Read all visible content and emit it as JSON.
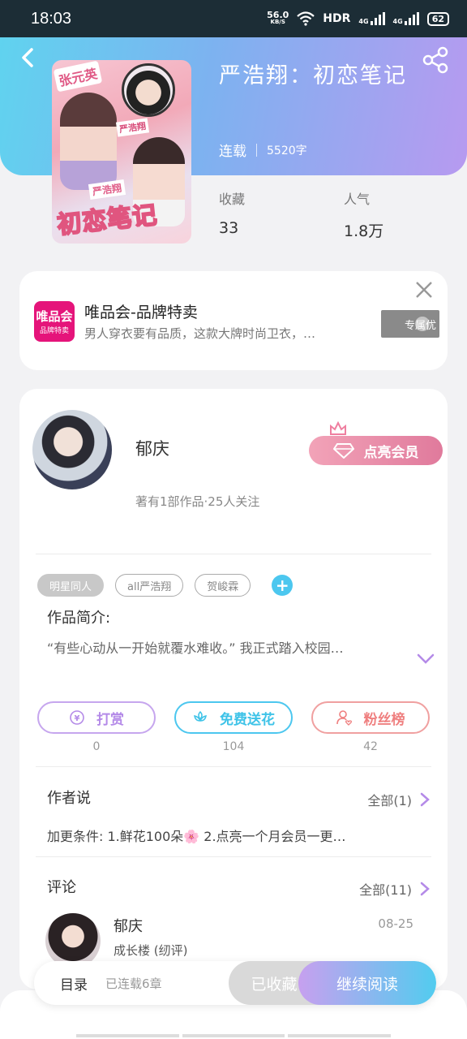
{
  "status_bar": {
    "time": "18:03",
    "net_speed": "56.0",
    "net_unit": "KB/S",
    "hd": "HDR",
    "sig1": "4G",
    "sig2": "4G",
    "battery": "62"
  },
  "book": {
    "title": "严浩翔：初恋笔记",
    "status": "连载",
    "word_count": "5520字",
    "cover_tags": [
      "张元英",
      "严浩翔",
      "严浩翔",
      "初恋笔记"
    ],
    "stats": [
      {
        "label": "收藏",
        "value": "33"
      },
      {
        "label": "人气",
        "value": "1.8万"
      }
    ]
  },
  "ad": {
    "logo_main": "唯品会",
    "logo_sub": "品牌特卖",
    "title": "唯品会-品牌特卖",
    "desc": "男人穿衣要有品质，这款大牌时尚卫衣，…",
    "button": "专属优"
  },
  "author": {
    "name": "郁庆",
    "info": "著有1部作品·25人关注",
    "vip_button": "点亮会员"
  },
  "tags": [
    "明星同人",
    "all严浩翔",
    "贺峻霖"
  ],
  "intro": {
    "label": "作品简介:",
    "text": "“有些心动从一开始就覆水难收。”  我正式踏入校园…"
  },
  "actions": [
    {
      "label": "打赏",
      "count": "0",
      "color": "#b48ae8",
      "icon": "coin-icon"
    },
    {
      "label": "免费送花",
      "count": "104",
      "color": "#3ec3e8",
      "icon": "flower-icon"
    },
    {
      "label": "粉丝榜",
      "count": "42",
      "color": "#ef7f7f",
      "icon": "fan-icon"
    }
  ],
  "author_says": {
    "title": "作者说",
    "all": "全部(1)",
    "text": "加更条件: 1.鲜花100朵🌸 2.点亮一个月会员一更…"
  },
  "comments": {
    "title": "评论",
    "all": "全部(11)",
    "first": {
      "name": "郁庆",
      "date": "08-25",
      "text": "成长楼 (纫评)"
    }
  },
  "bottom_bar": {
    "toc": "目录",
    "serial": "已连载6章",
    "collected": "已收藏",
    "read": "继续阅读"
  },
  "colors": {
    "header_start": "#5fd4ef",
    "header_end": "#b79af0",
    "vip": "#e07a9c",
    "accent_blue": "#4cc7ef"
  }
}
